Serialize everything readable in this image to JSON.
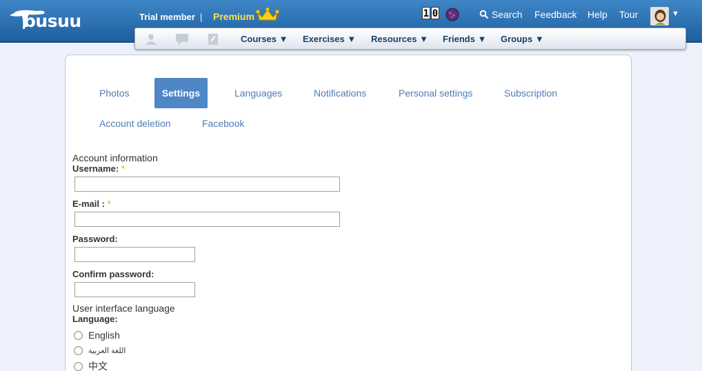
{
  "header": {
    "logo_text": "busuu",
    "membership": "Trial member",
    "separator": "|",
    "premium_label": "Premium",
    "points": [
      "1",
      "0"
    ],
    "search_label": "Search",
    "feedback_label": "Feedback",
    "help_label": "Help",
    "tour_label": "Tour",
    "avatar_caret": "▼"
  },
  "subnav": {
    "icons": [
      "profile-icon",
      "chat-icon",
      "notebook-icon"
    ],
    "menus": [
      {
        "label": "Courses ▼"
      },
      {
        "label": "Exercises ▼"
      },
      {
        "label": "Resources ▼"
      },
      {
        "label": "Friends ▼"
      },
      {
        "label": "Groups ▼"
      }
    ]
  },
  "tabs": {
    "photos": "Photos",
    "settings": "Settings",
    "languages": "Languages",
    "notifications": "Notifications",
    "personal_settings": "Personal settings",
    "subscription": "Subscription",
    "account_deletion": "Account deletion",
    "facebook": "Facebook",
    "active": "settings"
  },
  "form": {
    "account_section": "Account information",
    "username_label": "Username:",
    "username_value": "",
    "email_label": "E-mail :",
    "email_value": "",
    "password_label": "Password:",
    "confirm_password_label": "Confirm password:",
    "required_marker": "*",
    "ui_section": "User interface language",
    "language_label": "Language:",
    "languages": [
      {
        "label": "English"
      },
      {
        "label": "اللغة العربية"
      },
      {
        "label": "中文"
      }
    ]
  },
  "colors": {
    "header_blue": "#2f74b8",
    "premium_yellow": "#ffe14d",
    "active_tab": "#4f86c6",
    "tab_text": "#4f7bb3",
    "required": "#f0a000"
  }
}
